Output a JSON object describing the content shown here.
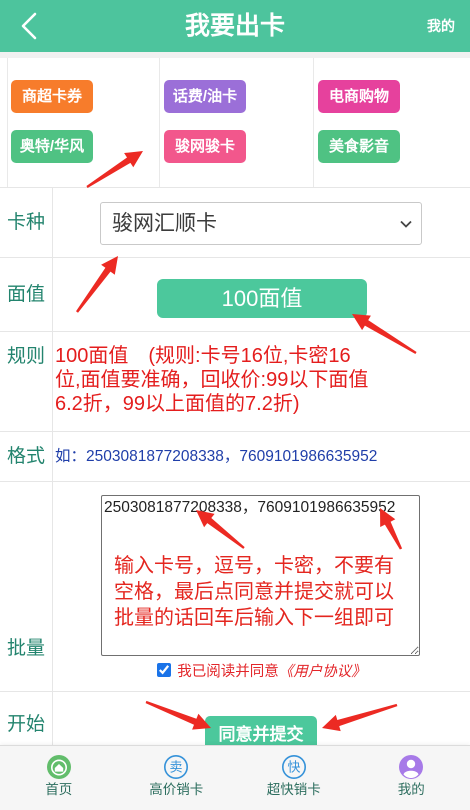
{
  "header": {
    "title": "我要出卡",
    "right_link": "我的",
    "back_icon": "chevron-left-icon"
  },
  "categories": [
    {
      "label": "商超卡券",
      "color": "#f77c2b"
    },
    {
      "label": "话费/油卡",
      "color": "#9b6fd8"
    },
    {
      "label": "电商购物",
      "color": "#e6419d"
    },
    {
      "label": "奥特/华风",
      "color": "#4fc283"
    },
    {
      "label": "骏网骏卡",
      "color": "#f2578c"
    },
    {
      "label": "美食影音",
      "color": "#4fc283"
    }
  ],
  "form": {
    "card_type": {
      "label": "卡种",
      "selected": "骏网汇顺卡"
    },
    "face_value": {
      "label": "面值",
      "button_label": "100面值"
    },
    "rules": {
      "label": "规则",
      "lines": [
        "100面值　(规则:卡号16位,卡密16",
        "位,面值要准确，回收价:99以下面值",
        "6.2折，99以上面值的7.2折)"
      ]
    },
    "format": {
      "label": "格式",
      "example": "如：2503081877208338，7609101986635952"
    },
    "batch": {
      "label": "批量",
      "value": "2503081877208338，7609101986635952",
      "agreement_checked": true,
      "agreement_text": "我已阅读并同意",
      "agreement_link": "《用户协议》"
    },
    "start": {
      "label": "开始",
      "submit_label": "同意并提交"
    }
  },
  "annotation": {
    "note_lines": [
      "输入卡号，逗号，卡密，不要有",
      "空格，最后点同意并提交就可以",
      "批量的话回车后输入下一组即可"
    ],
    "arrow_color": "#ec2a23"
  },
  "bottom_nav": [
    {
      "label": "首页",
      "icon": "home-icon"
    },
    {
      "label": "高价销卡",
      "icon": "sell-icon",
      "glyph": "卖"
    },
    {
      "label": "超快销卡",
      "icon": "fast-sell-icon",
      "glyph": "快"
    },
    {
      "label": "我的",
      "icon": "user-icon"
    }
  ]
}
